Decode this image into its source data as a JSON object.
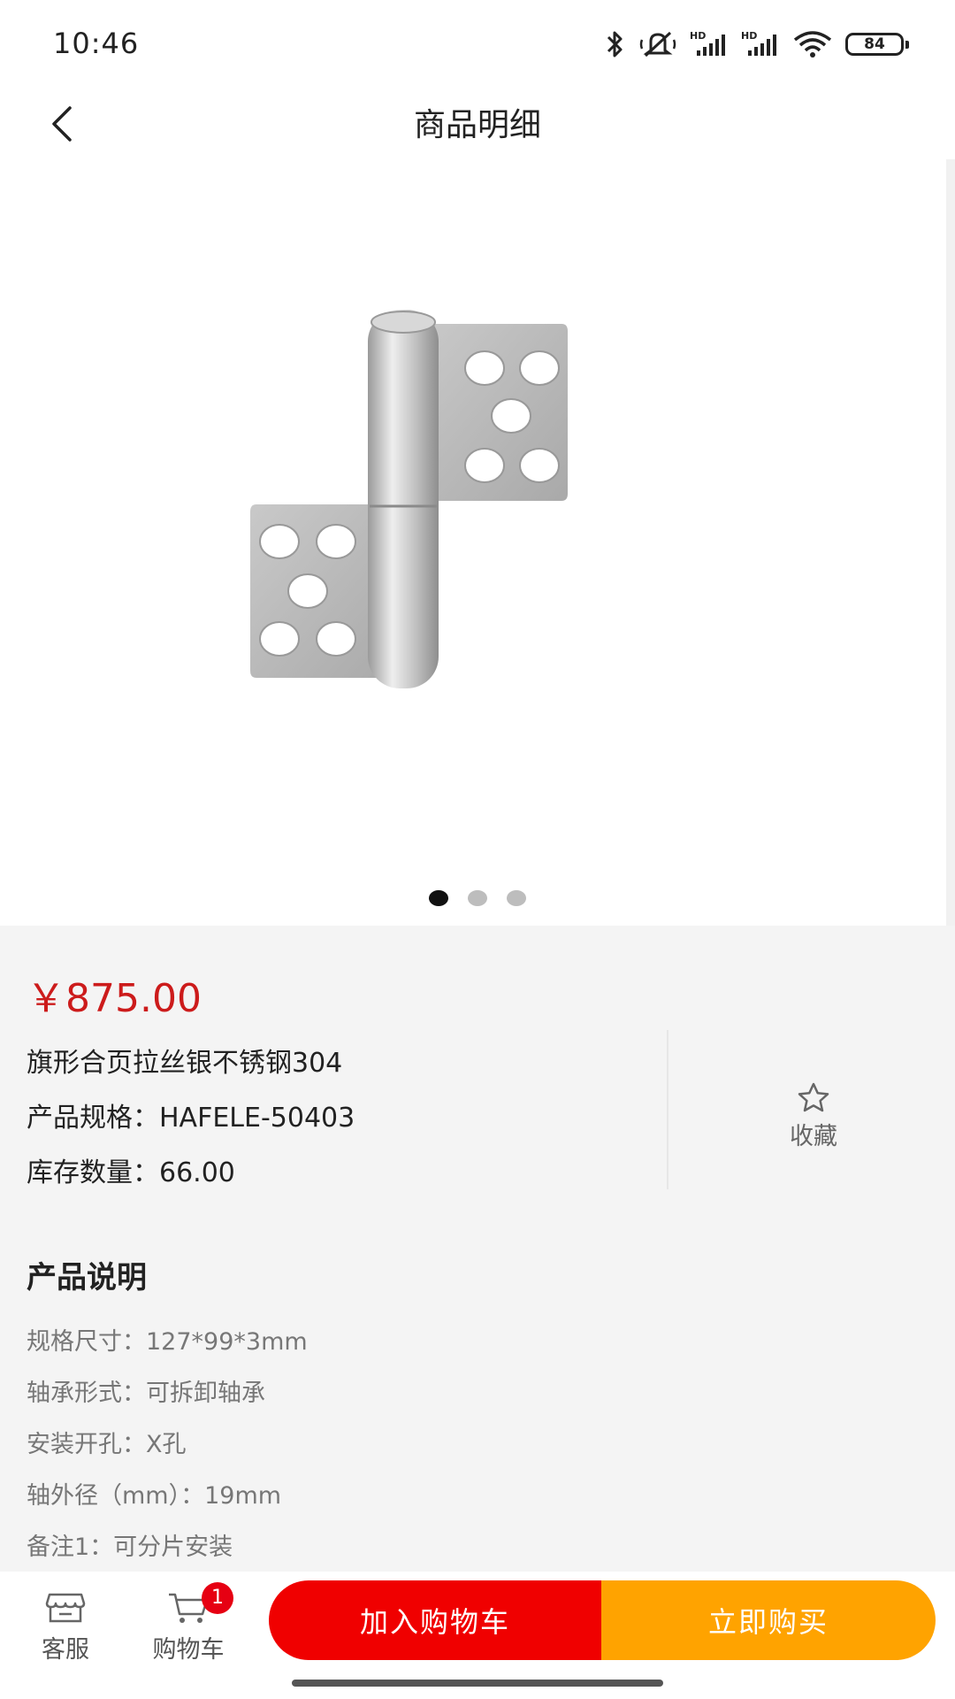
{
  "status_bar": {
    "time": "10:46",
    "battery_level": "84",
    "icons": [
      "bluetooth-icon",
      "mute-icon",
      "hd-signal-icon",
      "hd-signal-icon",
      "wifi-icon",
      "battery-icon"
    ],
    "hd_label": "HD"
  },
  "nav": {
    "title": "商品明细",
    "back_icon": "chevron-left-icon"
  },
  "gallery": {
    "image_icon": "door-hinge-image",
    "slide_count": 3,
    "active_slide": 0
  },
  "product": {
    "price": "￥875.00",
    "name": "旗形合页拉丝银不锈钢304",
    "spec_label": "产品规格：",
    "spec_value": "HAFELE-50403",
    "stock_label": "库存数量：",
    "stock_value": "66.00",
    "favorite_label": "收藏",
    "favorite_icon": "star-outline-icon"
  },
  "description": {
    "title": "产品说明",
    "items": [
      "规格尺寸：127*99*3mm",
      "轴承形式：可拆卸轴承",
      "安装开孔：X孔",
      "轴外径（mm）：19mm",
      "备注1：可分片安装"
    ]
  },
  "bottom_bar": {
    "service_label": "客服",
    "service_icon": "store-icon",
    "cart_label": "购物车",
    "cart_icon": "cart-icon",
    "cart_badge": "1",
    "add_to_cart": "加入购物车",
    "buy_now": "立即购买"
  },
  "colors": {
    "price": "#cc1b1b",
    "add_to_cart_bg": "#f00000",
    "buy_now_bg": "#ffa300",
    "badge_bg": "#e60012",
    "section_bg": "#f4f4f4"
  }
}
